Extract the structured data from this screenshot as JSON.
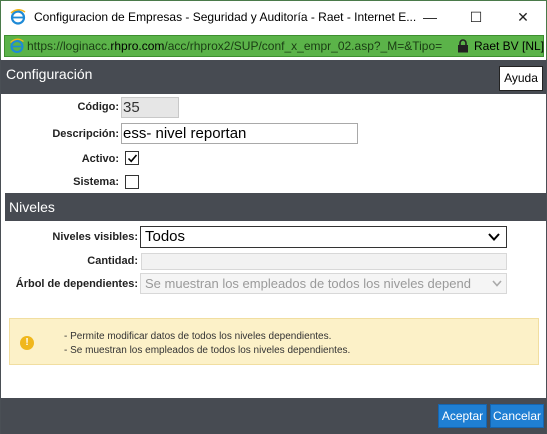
{
  "window": {
    "title": "Configuracion de Empresas - Seguridad y Auditoría - Raet - Internet E...",
    "minimize_glyph": "—",
    "maximize_glyph": "☐",
    "close_glyph": "✕"
  },
  "address_bar": {
    "url_prefix": "https://loginacc.",
    "url_domain": "rhpro.com",
    "url_path": "/acc/rhprox2/SUP/conf_x_empr_02.asp?_M=&Tipo=",
    "certificate": "Raet BV [NL]"
  },
  "header": {
    "title": "Configuración",
    "help_label": "Ayuda"
  },
  "form": {
    "codigo_label": "Código:",
    "codigo_value": "35",
    "descripcion_label": "Descripción:",
    "descripcion_value": "ess- nivel reportan",
    "activo_label": "Activo:",
    "activo_checked": true,
    "sistema_label": "Sistema:",
    "sistema_checked": false
  },
  "niveles": {
    "section_title": "Niveles",
    "visibles_label": "Niveles visibles:",
    "visibles_value": "Todos",
    "cantidad_label": "Cantidad:",
    "cantidad_value": "",
    "arbol_label": "Árbol de dependientes:",
    "arbol_value": "Se muestran los empleados de todos los niveles depend"
  },
  "alert": {
    "icon": "exclamation-icon",
    "color": "#f0b71c",
    "lines": [
      "- Permite modificar datos de todos los niveles dependientes.",
      "- Se muestran los empleados de todos los niveles dependientes."
    ]
  },
  "footer": {
    "accept_label": "Aceptar",
    "cancel_label": "Cancelar"
  },
  "colors": {
    "header_bg": "#474b52",
    "address_bar_bg": "#5bb349",
    "button_bg": "#1f7fd3",
    "alert_bg": "#fcf1c8"
  }
}
